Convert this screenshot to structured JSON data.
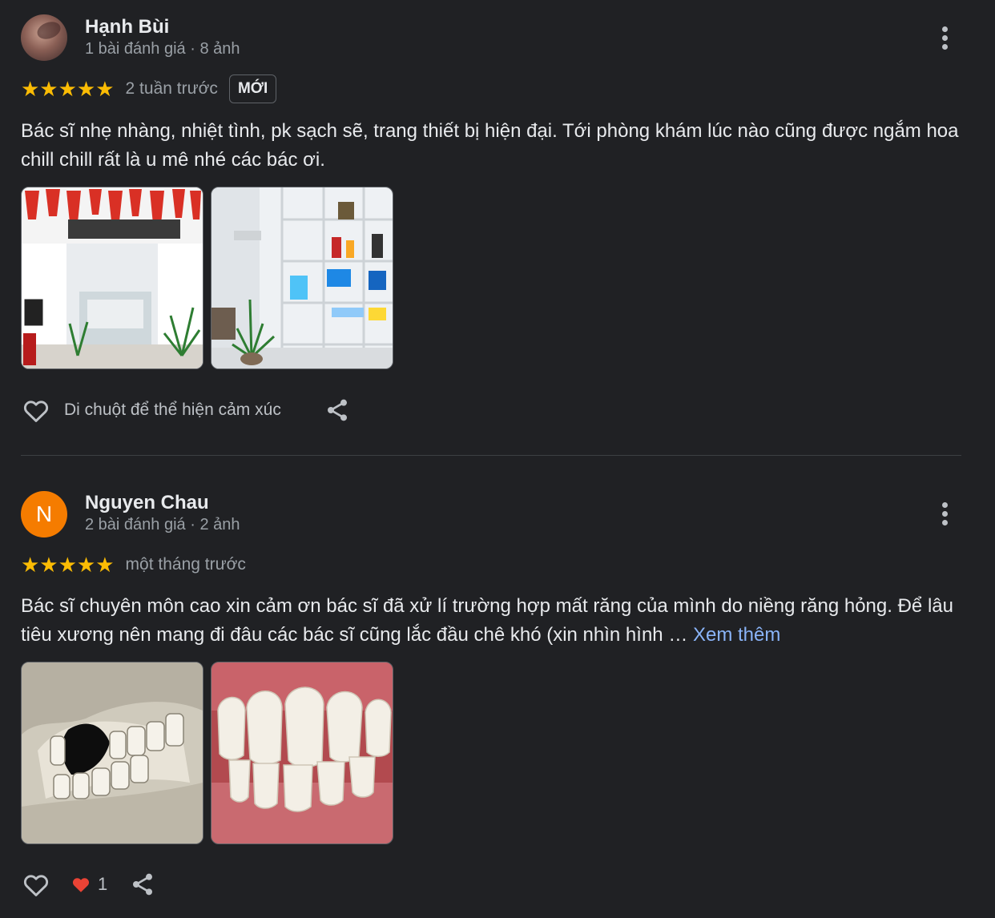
{
  "reviews": [
    {
      "name": "Hạnh Bùi",
      "meta": "1 bài đánh giá · 8 ảnh",
      "stars": "★★★★★",
      "when": "2 tuần trước",
      "badge": "MỚI",
      "text": "Bác sĩ nhẹ nhàng, nhiệt tình, pk sạch sẽ, trang thiết bị hiện đại. Tới phòng khám lúc nào cũng được ngắm hoa chill chill rất là u mê nhé các bác ơi.",
      "react_label": "Di chuột để thể hiện cảm xúc"
    },
    {
      "avatar_letter": "N",
      "name": "Nguyen Chau",
      "meta": "2 bài đánh giá · 2 ảnh",
      "stars": "★★★★★",
      "when": "một tháng trước",
      "text": "Bác sĩ chuyên môn cao xin cảm ơn bác sĩ đã xử lí trường hợp mất răng của mình do niềng răng hỏng. Để lâu tiêu xương nên mang đi đâu các bác sĩ cũng lắc đầu chê khó (xin nhìn hình … ",
      "more": "Xem thêm",
      "reaction_count": "1"
    }
  ],
  "colors": {
    "background": "#202124",
    "star": "#fbbc04",
    "link": "#8ab4f8",
    "avatar": "#f57c00",
    "heart": "#ea4335"
  },
  "icons": [
    "heart-outline-icon",
    "share-icon",
    "more-vert-icon",
    "heart-filled-icon"
  ]
}
